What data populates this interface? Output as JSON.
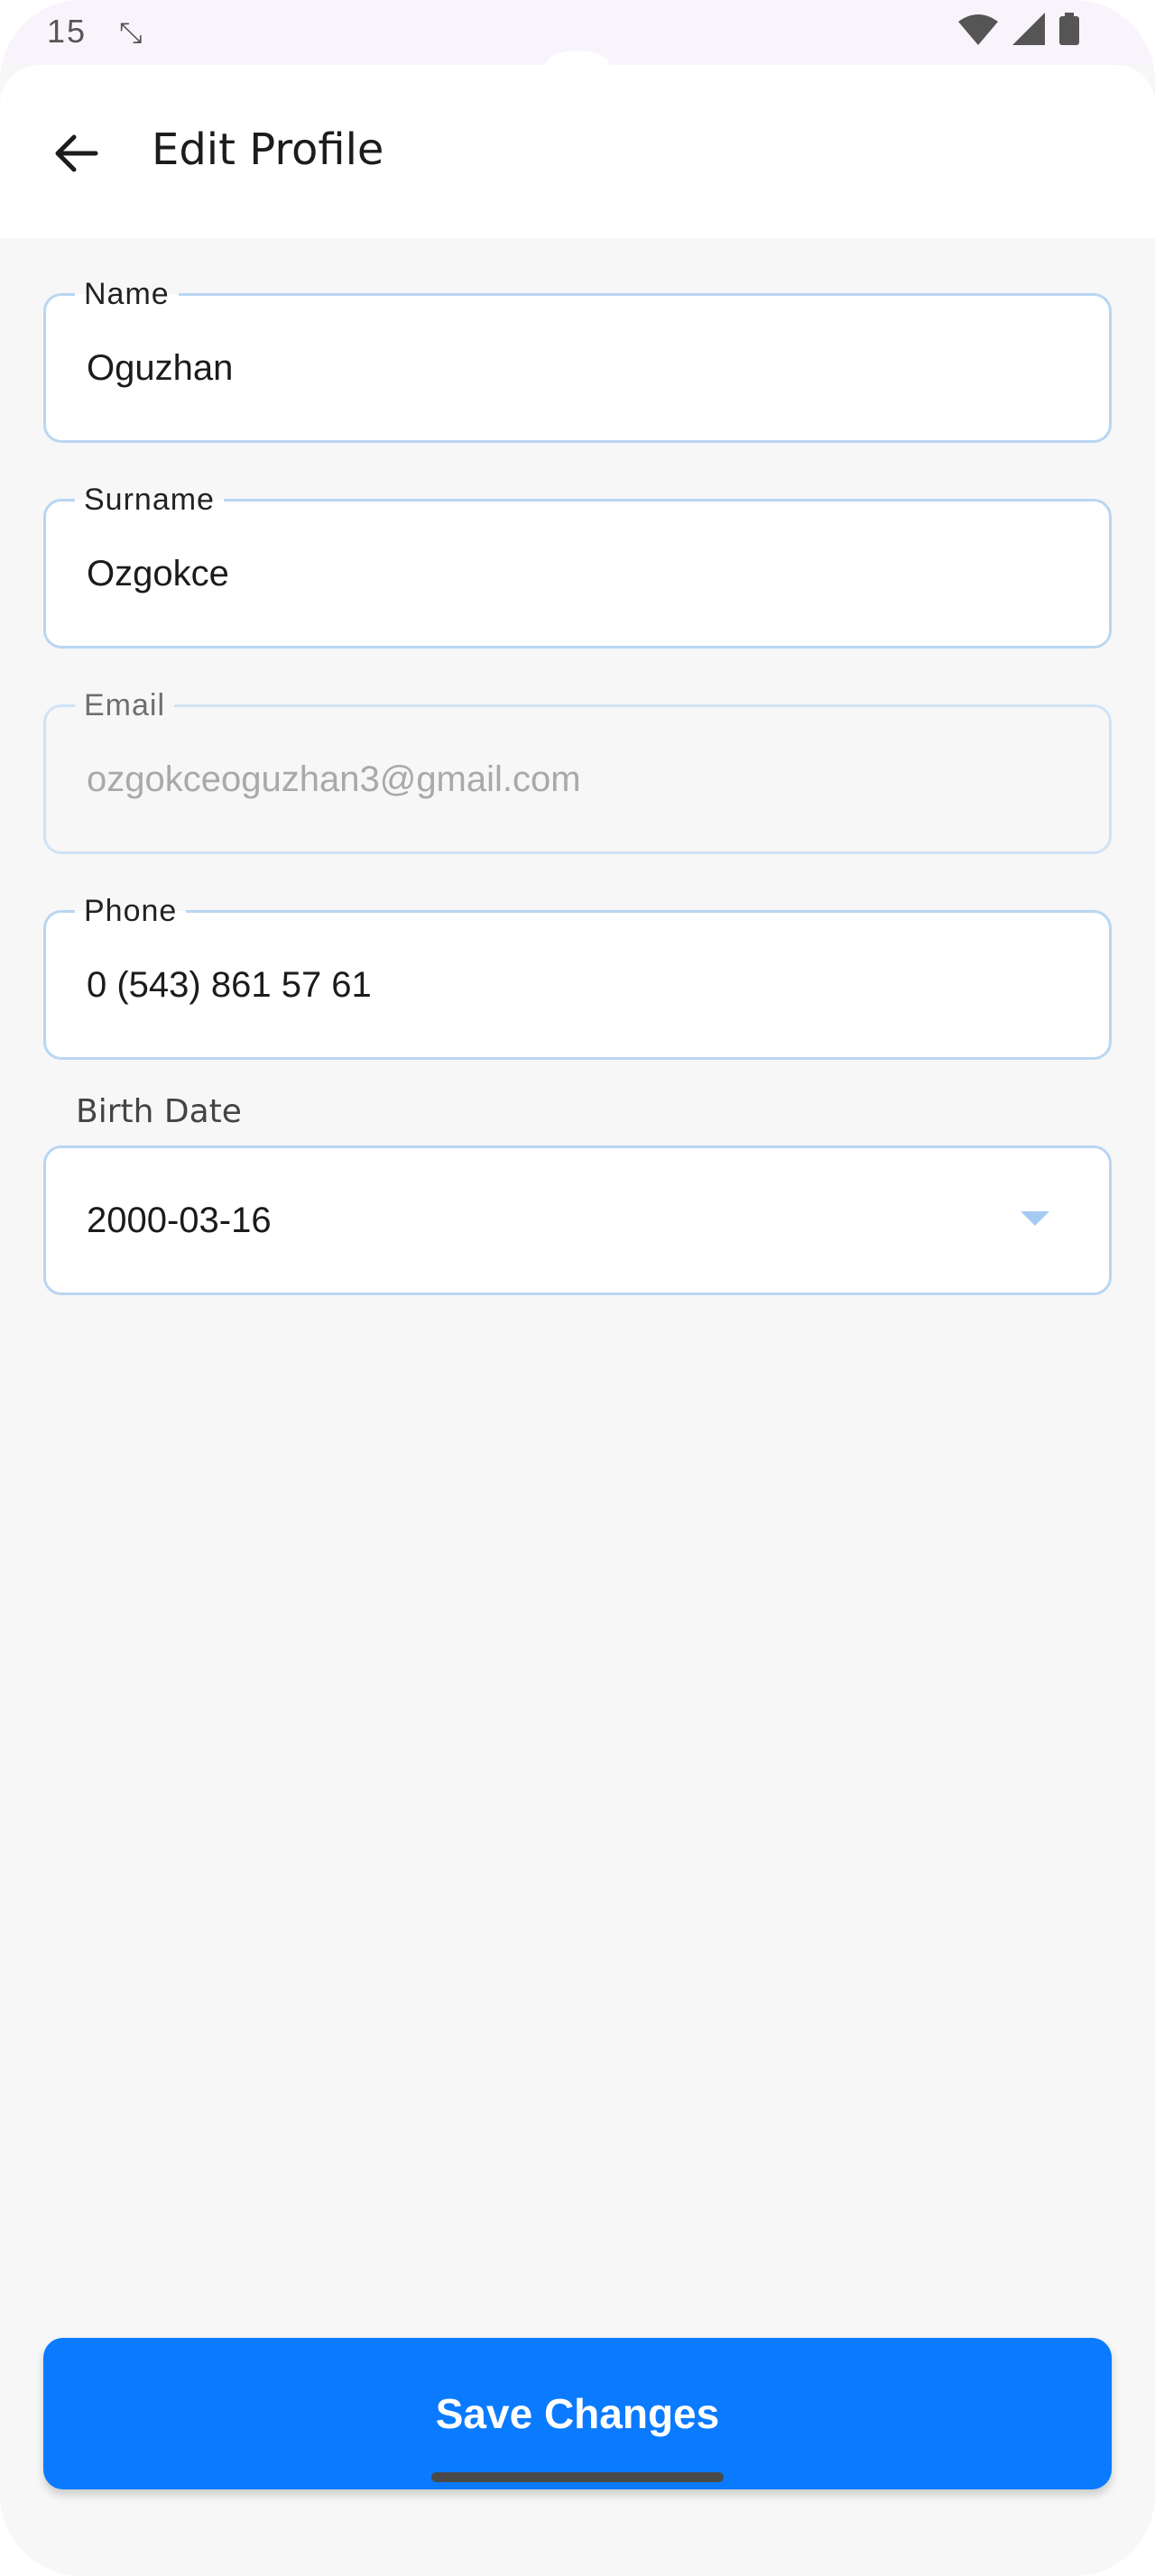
{
  "status_bar": {
    "time": "15",
    "wifi_icon": "wifi-icon",
    "signal_icon": "signal-icon",
    "battery_icon": "battery-icon",
    "extra_icon": "compress-arrows-icon"
  },
  "app_bar": {
    "title": "Edit Profile",
    "back_icon": "arrow-left-icon"
  },
  "form": {
    "name": {
      "label": "Name",
      "value": "Oguzhan"
    },
    "surname": {
      "label": "Surname",
      "value": "Ozgokce"
    },
    "email": {
      "label": "Email",
      "value": "ozgokceoguzhan3@gmail.com",
      "disabled": true
    },
    "phone": {
      "label": "Phone",
      "value": "0 (543) 861 57 61"
    },
    "birth_date": {
      "label": "Birth Date",
      "value": "2000-03-16",
      "icon": "caret-down-icon"
    }
  },
  "actions": {
    "save_label": "Save Changes"
  },
  "colors": {
    "primary": "#0a7bff",
    "field_border": "#b9d6f2",
    "background": "#f7f7f7"
  }
}
